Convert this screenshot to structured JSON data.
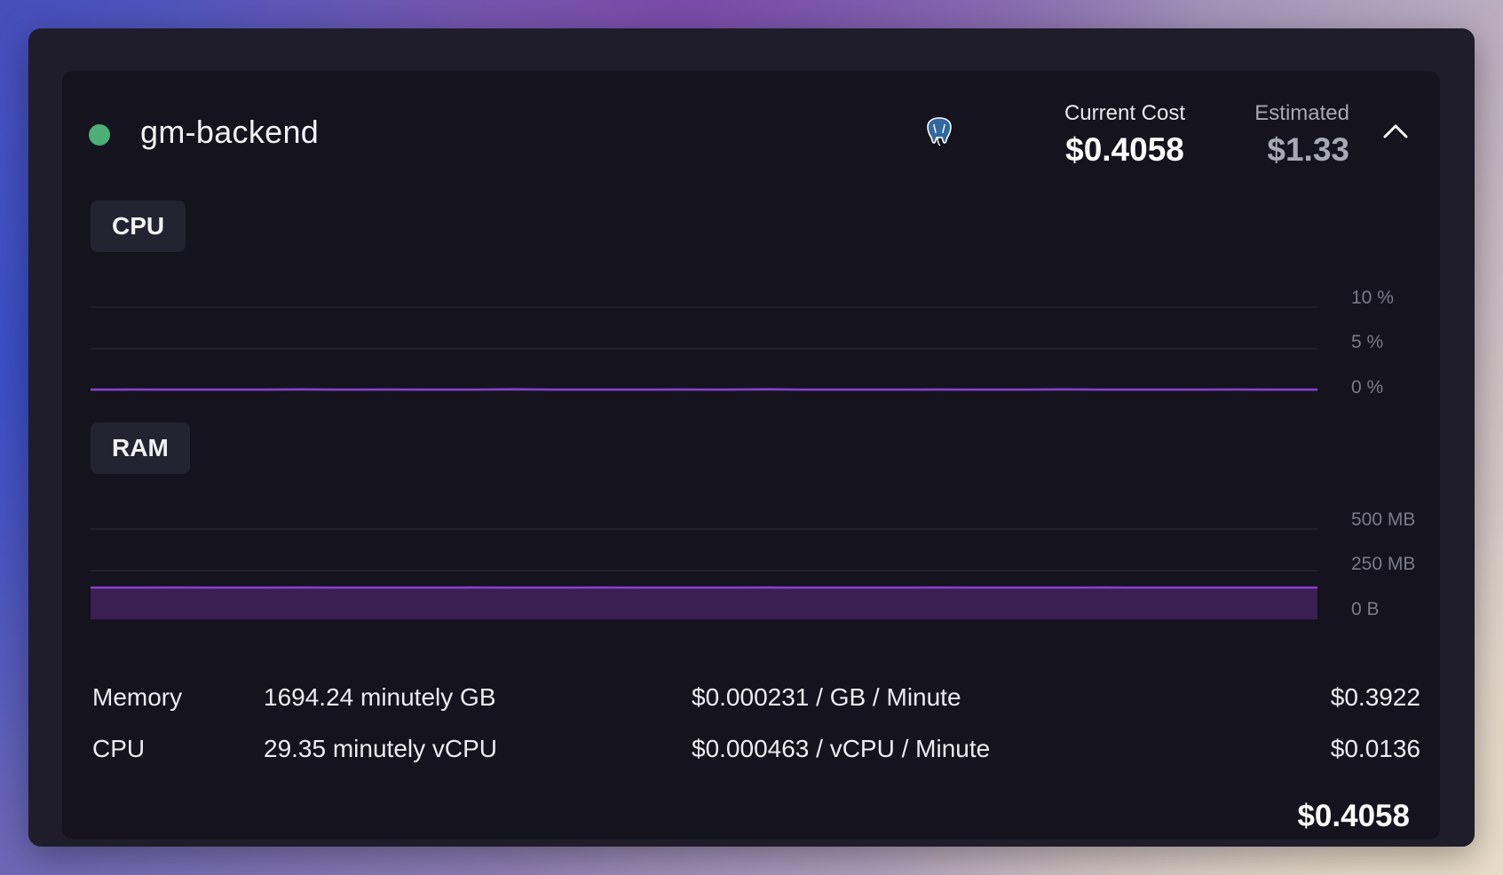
{
  "service": {
    "name": "gm-backend",
    "status_color": "#4caf78",
    "db_icon": "postgres-elephant-icon"
  },
  "costs": {
    "current_label": "Current Cost",
    "current_value": "$0.4058",
    "estimated_label": "Estimated",
    "estimated_value": "$1.33"
  },
  "cpu": {
    "label": "CPU",
    "ticks": [
      "10 %",
      "5 %",
      "0 %"
    ]
  },
  "ram": {
    "label": "RAM",
    "ticks": [
      "500 MB",
      "250 MB",
      "0 B"
    ]
  },
  "chart_data": [
    {
      "type": "line",
      "title": "CPU",
      "ylim": [
        0,
        10
      ],
      "y_unit": "%",
      "color": "#8a3fd1",
      "series": [
        {
          "values": [
            0.1,
            0.12,
            0.1,
            0.11,
            0.1,
            0.13,
            0.1,
            0.12,
            0.1,
            0.1,
            0.14,
            0.1,
            0.11,
            0.1,
            0.12,
            0.1,
            0.15,
            0.1,
            0.11,
            0.1,
            0.12,
            0.1,
            0.1,
            0.13,
            0.1,
            0.11,
            0.1,
            0.12,
            0.1,
            0.1
          ]
        }
      ]
    },
    {
      "type": "area",
      "title": "RAM",
      "ylim": [
        0,
        500
      ],
      "y_unit": "MB",
      "color": "#8a3fd1",
      "fill": "#3a1f52",
      "series": [
        {
          "values": [
            148,
            148,
            149,
            148,
            148,
            149,
            148,
            148,
            148,
            149,
            148,
            148,
            149,
            148,
            148,
            148,
            149,
            148,
            148,
            148,
            149,
            148,
            148,
            148,
            149,
            148,
            148,
            148,
            148,
            148
          ]
        }
      ]
    }
  ],
  "usage": [
    {
      "name": "Memory",
      "quantity": "1694.24 minutely GB",
      "rate": "$0.000231 / GB / Minute",
      "amount": "$0.3922"
    },
    {
      "name": "CPU",
      "quantity": "29.35 minutely vCPU",
      "rate": "$0.000463 / vCPU / Minute",
      "amount": "$0.0136"
    }
  ],
  "total": "$0.4058"
}
